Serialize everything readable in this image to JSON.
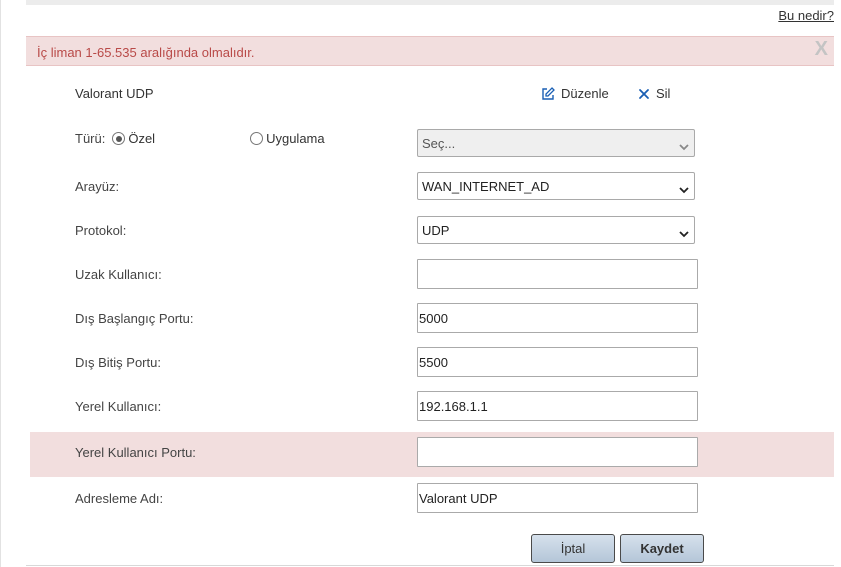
{
  "help_link": "Bu nedir?",
  "error": {
    "message": "İç liman 1-65.535 aralığında olmalıdır.",
    "close_symbol": "X"
  },
  "rule": {
    "title": "Valorant UDP",
    "edit_label": "Düzenle",
    "delete_label": "Sil"
  },
  "form": {
    "type": {
      "label": "Türü:",
      "option_custom": "Özel",
      "option_app": "Uygulama",
      "selected": "Özel",
      "app_select_value": "Seç..."
    },
    "interface": {
      "label": "Arayüz:",
      "value": "WAN_INTERNET_AD"
    },
    "protocol": {
      "label": "Protokol:",
      "value": "UDP"
    },
    "remote_host": {
      "label": "Uzak Kullanıcı:",
      "value": ""
    },
    "ext_start_port": {
      "label": "Dış Başlangıç Portu:",
      "value": "5000"
    },
    "ext_end_port": {
      "label": "Dış Bitiş Portu:",
      "value": "5500"
    },
    "local_host": {
      "label": "Yerel Kullanıcı:",
      "value": "192.168.1.1"
    },
    "local_port": {
      "label": "Yerel Kullanıcı Portu:",
      "value": "",
      "has_error": true
    },
    "mapping_name": {
      "label": "Adresleme Adı:",
      "value": "Valorant UDP"
    }
  },
  "buttons": {
    "cancel": "İptal",
    "save": "Kaydet"
  },
  "colors": {
    "error_bg": "#f2dede",
    "error_text": "#b94a48",
    "icon_blue": "#1a5fb4",
    "button_top": "#d6e1ec",
    "button_bottom": "#b4c6d8"
  },
  "icons": {
    "edit": "pencil-square-icon",
    "delete": "x-icon",
    "dropdown": "chevron-down-icon"
  }
}
